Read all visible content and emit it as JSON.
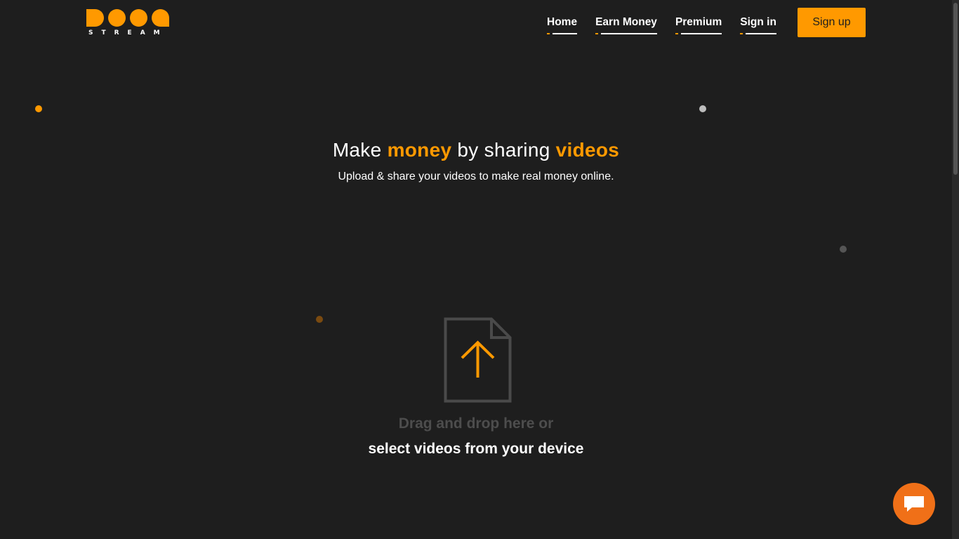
{
  "brand": {
    "logo_text": "STREAM",
    "accent_color": "#ff9900",
    "background_color": "#1e1e1e"
  },
  "nav": {
    "items": [
      {
        "label": "Home"
      },
      {
        "label": "Earn Money"
      },
      {
        "label": "Premium"
      },
      {
        "label": "Sign in"
      }
    ],
    "signup_label": "Sign up"
  },
  "hero": {
    "title_part1": "Make ",
    "title_accent1": "money",
    "title_part2": " by sharing ",
    "title_accent2": "videos",
    "subtitle": "Upload & share your videos to make real money online."
  },
  "upload": {
    "icon": "file-upload-icon",
    "drag_text": "Drag and drop here or",
    "select_text": "select videos from your device"
  },
  "chat": {
    "icon": "chat-bubble-icon",
    "color": "#f07018"
  }
}
